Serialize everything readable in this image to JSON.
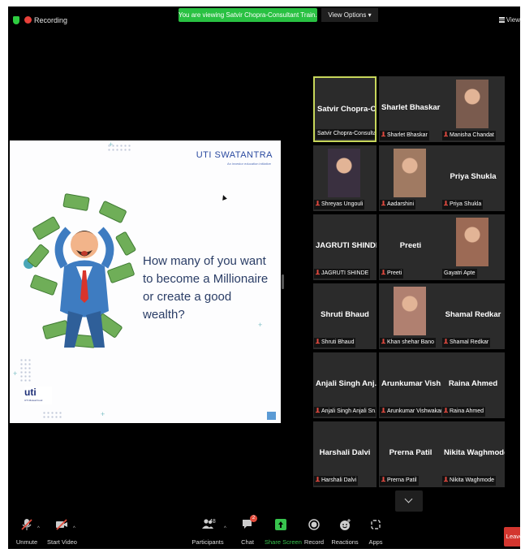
{
  "topbar": {
    "recording_label": "Recording",
    "viewing_banner": "You are viewing Satvir Chopra-Consultant Train...'s screen",
    "view_options": "View Options",
    "view_label": "View"
  },
  "slide": {
    "brand": "UTI SWATANTRA",
    "tagline": "An investor education initiative",
    "question": "How many of you want to become a Millionaire or create a good wealth?",
    "logo_text": "uti",
    "logo_sub": "UTI Mutual Fund"
  },
  "participants": [
    {
      "name": "Satvir  Chopra-C...",
      "label": "Satvir Chopra-Consultan...",
      "muted": false,
      "photo": false
    },
    {
      "name": "Sharlet Bhaskar",
      "label": "Sharlet Bhaskar",
      "muted": true,
      "photo": false
    },
    {
      "name": "",
      "label": "Manisha Chandat",
      "muted": true,
      "photo": true
    },
    {
      "name": "",
      "label": "Shreyas Ungouli",
      "muted": true,
      "photo": true
    },
    {
      "name": "",
      "label": "Aadarshini",
      "muted": true,
      "photo": true
    },
    {
      "name": "Priya Shukla",
      "label": "Priya Shukla",
      "muted": true,
      "photo": false
    },
    {
      "name": "JAGRUTI SHINDE",
      "label": "JAGRUTI SHINDE",
      "muted": true,
      "photo": false
    },
    {
      "name": "Preeti",
      "label": "Preeti",
      "muted": true,
      "photo": false
    },
    {
      "name": "",
      "label": "Gayatri Apte",
      "muted": false,
      "photo": true
    },
    {
      "name": "Shruti Bhaud",
      "label": "Shruti Bhaud",
      "muted": true,
      "photo": false
    },
    {
      "name": "",
      "label": "Khan shehar Bano",
      "muted": true,
      "photo": true
    },
    {
      "name": "Shamal Redkar",
      "label": "Shamal Redkar",
      "muted": true,
      "photo": false
    },
    {
      "name": "Anjali Singh Anj...",
      "label": "Anjali Singh Anjali Sn...",
      "muted": true,
      "photo": false
    },
    {
      "name": "Arunkumar  Vish...",
      "label": "Arunkumar Vishwakar...",
      "muted": true,
      "photo": false
    },
    {
      "name": "Raina Ahmed",
      "label": "Raina Ahmed",
      "muted": true,
      "photo": false
    },
    {
      "name": "Harshali Dalvi",
      "label": "Harshali Dalvi",
      "muted": true,
      "photo": false
    },
    {
      "name": "Prerna Patil",
      "label": "Prerna Patil",
      "muted": true,
      "photo": false
    },
    {
      "name": "Nikita Waghmode",
      "label": "Nikita Waghmode",
      "muted": true,
      "photo": false
    }
  ],
  "toolbar": {
    "unmute": "Unmute",
    "start_video": "Start Video",
    "participants": "Participants",
    "participants_count": "48",
    "chat": "Chat",
    "chat_badge": "2",
    "share_screen": "Share Screen",
    "record": "Record",
    "reactions": "Reactions",
    "apps": "Apps",
    "leave": "Leave"
  },
  "colors": {
    "banner_green": "#29c142",
    "active_speaker": "#c7d65b",
    "leave_red": "#d3362f",
    "tile_bg": "#2b2b2b"
  }
}
